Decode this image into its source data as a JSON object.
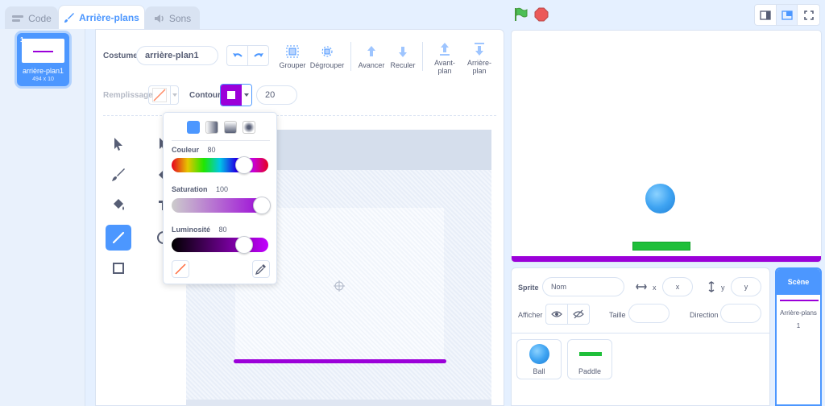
{
  "tabs": [
    {
      "label": "Code",
      "icon": "code-icon"
    },
    {
      "label": "Arrière-plans",
      "icon": "brush-icon"
    },
    {
      "label": "Sons",
      "icon": "speaker-icon"
    }
  ],
  "costume_list": {
    "index": "1",
    "name": "arrière-plan1",
    "size": "494 x 10"
  },
  "editor": {
    "costume_label": "Costume",
    "costume_name": "arrière-plan1",
    "buttons": {
      "group": "Grouper",
      "ungroup": "Dégrouper",
      "forward": "Avancer",
      "backward": "Reculer",
      "front": "Avant-plan",
      "back": "Arrière-plan"
    },
    "fill_label": "Remplissage",
    "outline_label": "Contour",
    "outline_width": "20",
    "outline_color": "#9b00d9"
  },
  "color_picker": {
    "color_label": "Couleur",
    "color_value": "80",
    "color_level": 80,
    "saturation_label": "Saturation",
    "saturation_value": "100",
    "saturation_level": 100,
    "brightness_label": "Luminosité",
    "brightness_value": "80",
    "brightness_level": 80
  },
  "sprite_info": {
    "sprite_label": "Sprite",
    "name_placeholder": "Nom",
    "x_label": "x",
    "x_placeholder": "x",
    "y_label": "y",
    "y_placeholder": "y",
    "show_label": "Afficher",
    "size_label": "Taille",
    "direction_label": "Direction"
  },
  "sprites": [
    {
      "name": "Ball",
      "icon": "ball-icon"
    },
    {
      "name": "Paddle",
      "icon": "paddle-icon"
    }
  ],
  "stage_panel": {
    "title": "Scène",
    "backdrops_label": "Arrière-plans",
    "backdrops_count": "1"
  },
  "colors": {
    "accent": "#4c97ff",
    "purple": "#9b00d9",
    "green_flag": "#4cbf56",
    "stop": "#ec5959",
    "paddle": "#1fbf3a"
  }
}
